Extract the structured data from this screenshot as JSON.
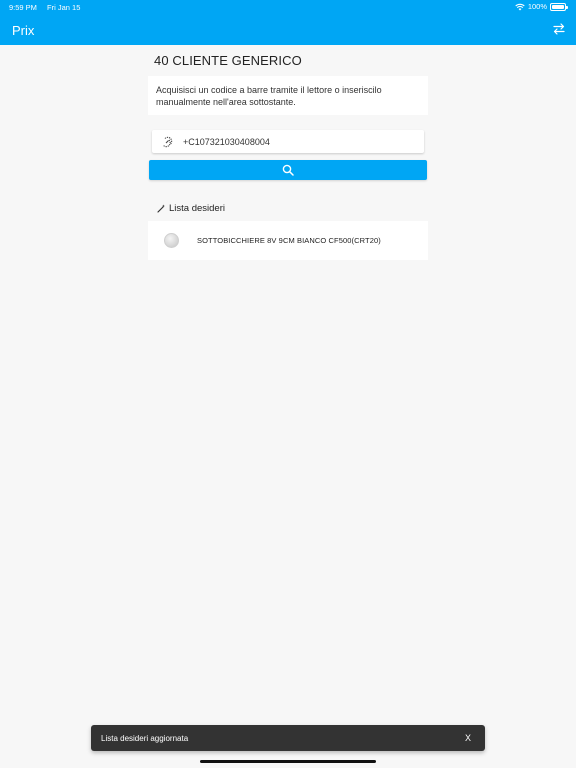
{
  "status_bar": {
    "time": "9:59 PM",
    "date": "Fri Jan 15",
    "battery": "100%",
    "battery_level": 1.0
  },
  "app_bar": {
    "title": "Prix",
    "switch_icon": "arrows-swap-icon"
  },
  "customer": {
    "title": "40 CLIENTE GENERICO"
  },
  "hint": {
    "text": "Acquisisci un codice a barre tramite il lettore o inseriscilo manualmente nell'area sottostante."
  },
  "barcode": {
    "icon": "barcode-scanner-icon",
    "value": "+C107321030408004"
  },
  "search": {
    "icon": "search-icon"
  },
  "wishlist": {
    "icon": "magic-wand-icon",
    "title": "Lista desideri",
    "items": [
      {
        "name": "SOTTOBICCHIERE 8V 9CM BIANCO CF500(CRT20)"
      }
    ]
  },
  "snackbar": {
    "message": "Lista desideri aggiornata",
    "close_label": "X"
  },
  "colors": {
    "primary": "#00a6f4",
    "background": "#f7f7f7",
    "snackbar": "#333333"
  }
}
